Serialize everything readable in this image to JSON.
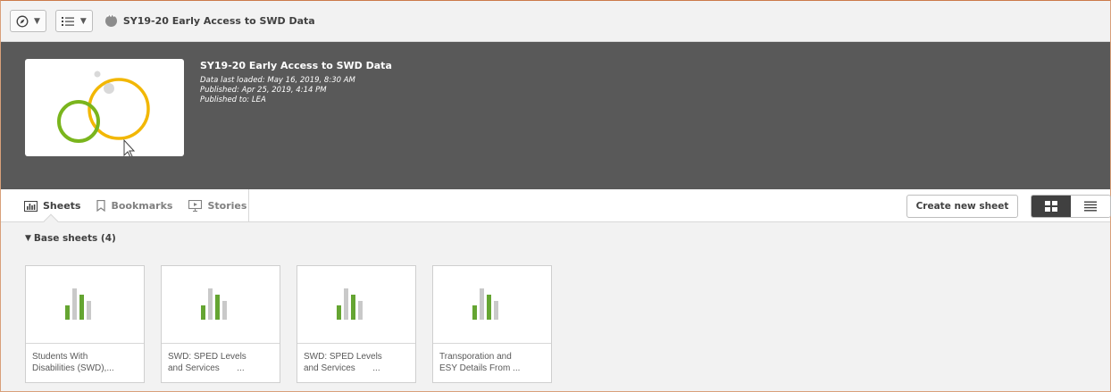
{
  "toolbar": {
    "nav_icon": "compass-icon",
    "menu_icon": "list-menu-icon",
    "app_title": "SY19-20 Early Access to SWD Data"
  },
  "hero": {
    "title": "SY19-20 Early Access to SWD Data",
    "data_loaded": "Data last loaded: May 16, 2019, 8:30 AM",
    "published": "Published: Apr 25, 2019, 4:14 PM",
    "published_to": "Published to: LEA"
  },
  "tabs": [
    {
      "label": "Sheets",
      "icon": "bar-chart-icon",
      "active": true
    },
    {
      "label": "Bookmarks",
      "icon": "bookmark-icon",
      "active": false
    },
    {
      "label": "Stories",
      "icon": "presentation-icon",
      "active": false
    }
  ],
  "actions": {
    "create_sheet": "Create new sheet"
  },
  "section": {
    "title": "Base sheets (4)"
  },
  "sheets": [
    {
      "title": "Students With\nDisabilities (SWD),..."
    },
    {
      "title": "SWD: SPED Levels\nand Services       ..."
    },
    {
      "title": "SWD: SPED Levels\nand Services       ..."
    },
    {
      "title": "Transporation and\nESY Details From ..."
    }
  ],
  "colors": {
    "green": "#65a532",
    "grey_bar": "#c9c9c9",
    "ring_yellow": "#f2b705",
    "ring_green": "#7ab51d",
    "hero_bg": "#595959"
  }
}
